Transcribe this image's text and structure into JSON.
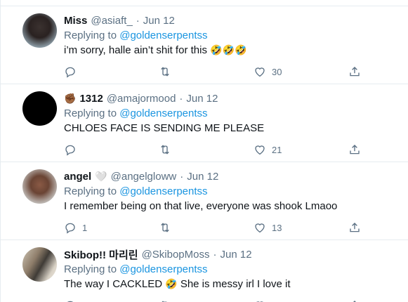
{
  "tweets": [
    {
      "name": "Miss",
      "handle": "@asiaft_",
      "date": "Jun 12",
      "reply_prefix": "Replying to",
      "reply_to": "@goldenserpentss",
      "text": "i’m sorry, halle ain’t shit for this",
      "text_emoji": "🤣🤣🤣",
      "replies": "",
      "likes": "30",
      "avatar": "profile-photo-person"
    },
    {
      "name": "1312",
      "name_emoji": "✊🏾",
      "handle": "@amajormood",
      "date": "Jun 12",
      "reply_prefix": "Replying to",
      "reply_to": "@goldenserpentss",
      "text": "CHLOES FACE IS SENDING ME PLEASE",
      "replies": "",
      "likes": "21",
      "avatar": "black-avatar"
    },
    {
      "name": "angel",
      "name_emoji": "🤍",
      "handle": "@angelgloww",
      "date": "Jun 12",
      "reply_prefix": "Replying to",
      "reply_to": "@goldenserpentss",
      "text": "I remember being on that live, everyone was shook Lmaoo",
      "replies": "1",
      "likes": "13",
      "avatar": "profile-photo-person"
    },
    {
      "name": "Skibop!! 마리린",
      "handle": "@SkibopMoss",
      "date": "Jun 12",
      "reply_prefix": "Replying to",
      "reply_to": "@goldenserpentss",
      "text": "The way I CACKLED",
      "text_emoji": "🤣",
      "text_after": "She is messy irl I love it",
      "avatar": "profile-photo-two-people"
    }
  ],
  "colors": {
    "accent": "#1b95e0",
    "muted": "#5b7083",
    "text": "#0f1419",
    "border": "#e6ecf0"
  },
  "icons": [
    "reply-icon",
    "retweet-icon",
    "like-icon",
    "share-icon"
  ]
}
